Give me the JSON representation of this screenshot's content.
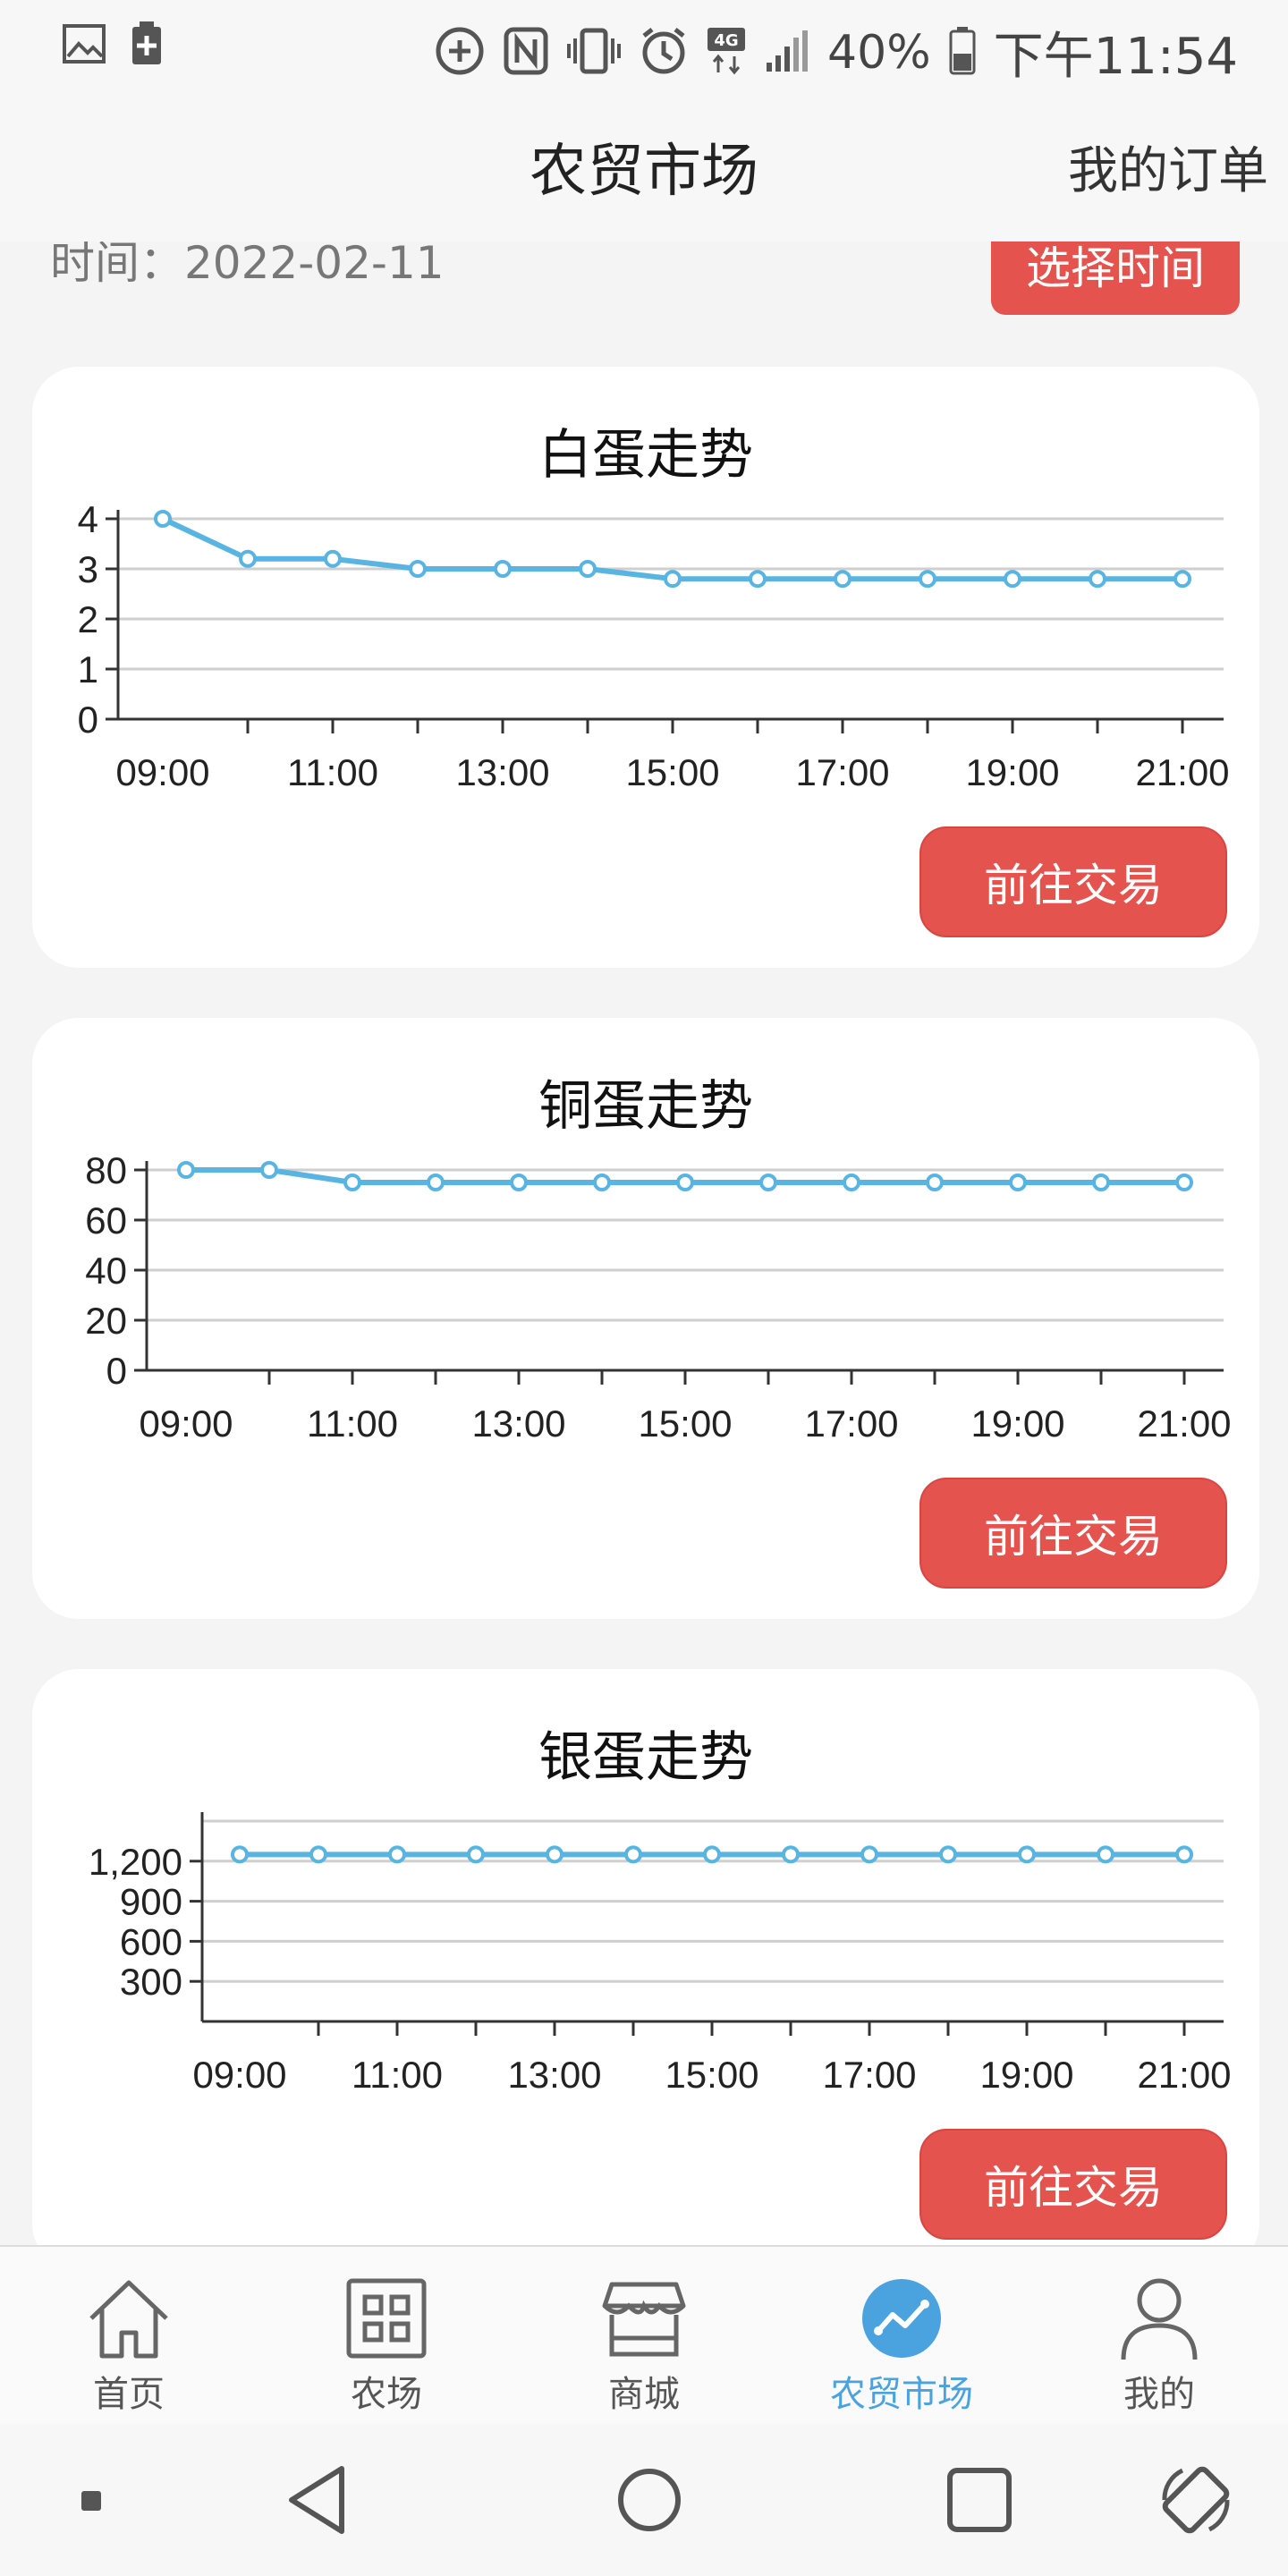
{
  "status_bar": {
    "battery_pct": "40%",
    "time": "下午11:54",
    "icons": [
      "gallery-icon",
      "battery-saver-icon",
      "sync-icon",
      "nfc-icon",
      "vibrate-icon",
      "alarm-icon",
      "4g-icon",
      "signal-icon",
      "battery-icon"
    ]
  },
  "header": {
    "title": "农贸市场",
    "orders_label": "我的订单"
  },
  "time_row": {
    "label": "时间：2022-02-11",
    "button_label": "选择时间"
  },
  "cards": [
    {
      "title": "白蛋走势",
      "button_label": "前往交易"
    },
    {
      "title": "铜蛋走势",
      "button_label": "前往交易"
    },
    {
      "title": "银蛋走势",
      "button_label": "前往交易"
    }
  ],
  "chart_data": [
    {
      "type": "line",
      "title": "白蛋走势",
      "x_ticks": [
        "09:00",
        "11:00",
        "13:00",
        "15:00",
        "17:00",
        "19:00",
        "21:00"
      ],
      "y_ticks": [
        "0",
        "1",
        "2",
        "3",
        "4"
      ],
      "ylim": [
        0,
        4
      ],
      "x": [
        "09:00",
        "10:00",
        "11:00",
        "12:00",
        "13:00",
        "14:00",
        "15:00",
        "16:00",
        "17:00",
        "18:00",
        "19:00",
        "20:00",
        "21:00"
      ],
      "values": [
        4.0,
        3.2,
        3.2,
        3.0,
        3.0,
        3.0,
        2.8,
        2.8,
        2.8,
        2.8,
        2.8,
        2.8,
        2.8
      ],
      "color": "#5ab4e2",
      "grid": true
    },
    {
      "type": "line",
      "title": "铜蛋走势",
      "x_ticks": [
        "09:00",
        "11:00",
        "13:00",
        "15:00",
        "17:00",
        "19:00",
        "21:00"
      ],
      "y_ticks": [
        "0",
        "20",
        "40",
        "60",
        "80"
      ],
      "ylim": [
        0,
        80
      ],
      "x": [
        "09:00",
        "10:00",
        "11:00",
        "12:00",
        "13:00",
        "14:00",
        "15:00",
        "16:00",
        "17:00",
        "18:00",
        "19:00",
        "20:00",
        "21:00"
      ],
      "values": [
        80,
        80,
        75,
        75,
        75,
        75,
        75,
        75,
        75,
        75,
        75,
        75,
        75
      ],
      "color": "#5ab4e2",
      "grid": true
    },
    {
      "type": "line",
      "title": "银蛋走势",
      "x_ticks": [
        "09:00",
        "11:00",
        "13:00",
        "15:00",
        "17:00",
        "19:00",
        "21:00"
      ],
      "y_ticks": [
        "300",
        "600",
        "900",
        "1,200"
      ],
      "ylim": [
        0,
        1500
      ],
      "x": [
        "09:00",
        "10:00",
        "11:00",
        "12:00",
        "13:00",
        "14:00",
        "15:00",
        "16:00",
        "17:00",
        "18:00",
        "19:00",
        "20:00",
        "21:00"
      ],
      "values": [
        1250,
        1250,
        1250,
        1250,
        1250,
        1250,
        1250,
        1250,
        1250,
        1250,
        1250,
        1250,
        1250
      ],
      "color": "#5ab4e2",
      "grid": true
    }
  ],
  "bottom_nav": [
    {
      "label": "首页",
      "icon": "home-icon",
      "active": false
    },
    {
      "label": "农场",
      "icon": "grid-icon",
      "active": false
    },
    {
      "label": "商城",
      "icon": "store-icon",
      "active": false
    },
    {
      "label": "农贸市场",
      "icon": "trend-icon",
      "active": true
    },
    {
      "label": "我的",
      "icon": "profile-icon",
      "active": false
    }
  ],
  "colors": {
    "accent_red": "#e5534f",
    "active_blue": "#4aa3df",
    "line_blue": "#5ab4e2"
  }
}
